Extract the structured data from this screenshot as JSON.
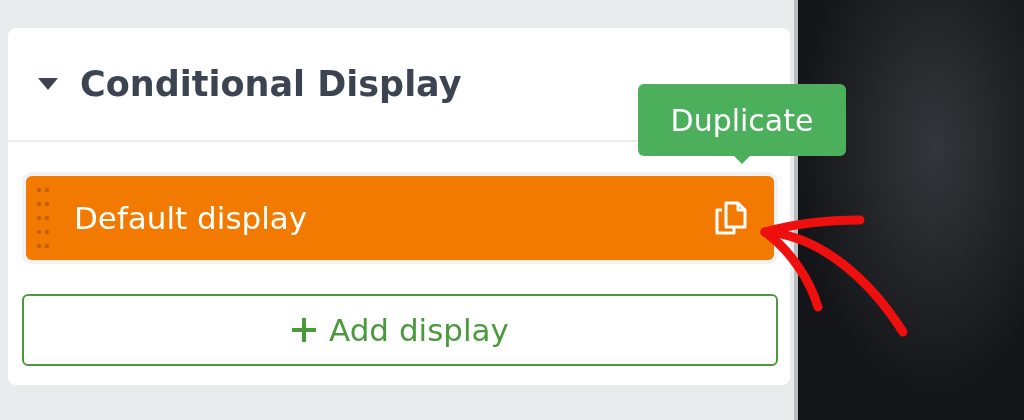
{
  "panel": {
    "title": "Conditional Display",
    "expanded": true
  },
  "displays": [
    {
      "label": "Default display"
    }
  ],
  "tooltip": {
    "label": "Duplicate"
  },
  "add_button": {
    "label": "Add display"
  }
}
